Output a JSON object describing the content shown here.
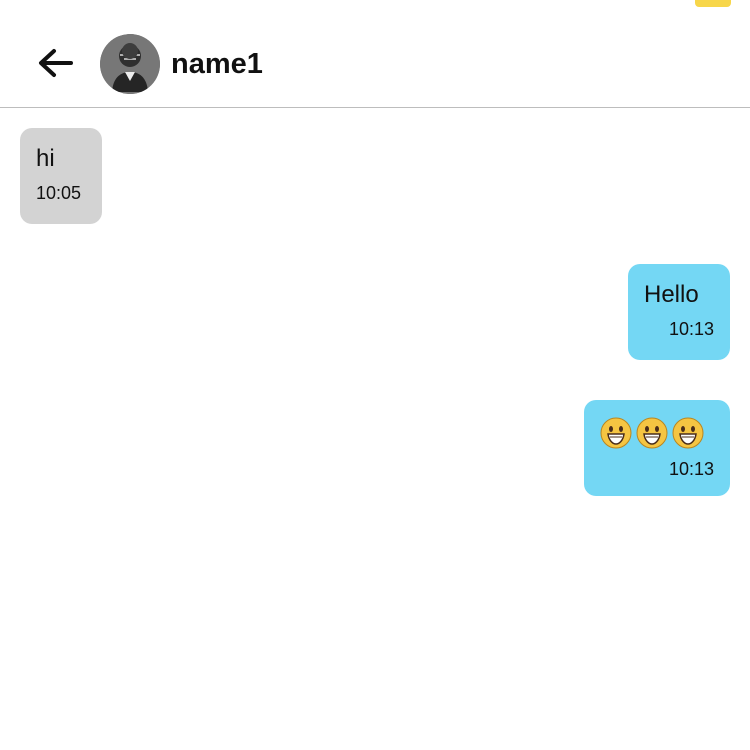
{
  "header": {
    "contact_name": "name1",
    "back_icon": "arrow-left-icon",
    "avatar": "contact-avatar"
  },
  "colors": {
    "incoming_bubble": "#d3d3d3",
    "outgoing_bubble": "#74d7f4",
    "top_indicator": "#f7d64a",
    "divider": "#bdbdbd"
  },
  "messages": [
    {
      "direction": "incoming",
      "text": "hi",
      "time": "10:05"
    },
    {
      "direction": "outgoing",
      "text": "Hello",
      "time": "10:13"
    },
    {
      "direction": "outgoing",
      "text": "😀😀😀",
      "emoji": [
        "grinning-face",
        "grinning-face",
        "grinning-face"
      ],
      "time": "10:13"
    }
  ]
}
